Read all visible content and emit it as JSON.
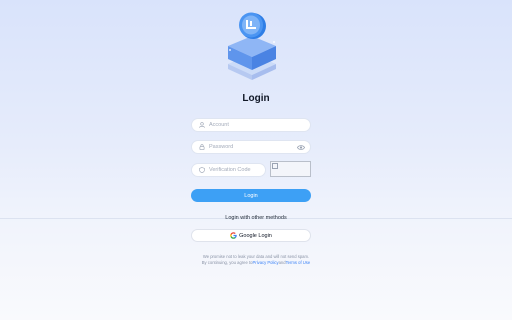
{
  "page": {
    "title": "Login"
  },
  "form": {
    "account_placeholder": "Account",
    "password_placeholder": "Password",
    "verification_placeholder": "Verification Code",
    "login_label": "Login"
  },
  "other": {
    "heading": "Login with other methods",
    "google_label": "Google Login"
  },
  "terms": {
    "line1": "We promise not to leak your data and will not send spam.",
    "line2_prefix": "By continuing, you agree to",
    "privacy_link": "Privacy Policy",
    "and_word": "and",
    "terms_link": "Terms of Use"
  },
  "icons": {
    "logo": "isometric-box-logo-icon",
    "account": "user-icon",
    "password": "lock-icon",
    "verification": "shield-icon",
    "show_password": "eye-icon",
    "google": "google-icon",
    "captcha": "broken-image-icon"
  },
  "colors": {
    "primary": "#3da0f5",
    "link": "#3b82f6"
  }
}
